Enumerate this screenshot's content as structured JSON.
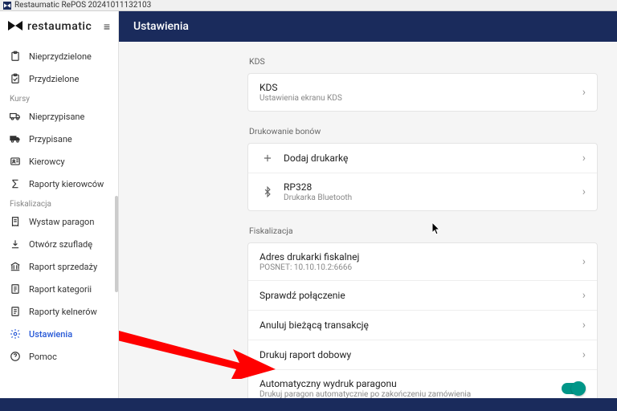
{
  "window": {
    "title": "Restaumatic RePOS 20241011132103"
  },
  "brand": {
    "name": "restaumatic"
  },
  "topbar": {
    "title": "Ustawienia"
  },
  "sidebar": {
    "items": [
      {
        "label": "Nieprzydzielone",
        "icon": "assignment"
      },
      {
        "label": "Przydzielone",
        "icon": "assignment-check"
      }
    ],
    "sections": [
      {
        "label": "Kursy",
        "items": [
          {
            "label": "Nieprzypisane",
            "icon": "truck-out"
          },
          {
            "label": "Przypisane",
            "icon": "truck"
          },
          {
            "label": "Kierowcy",
            "icon": "badge"
          },
          {
            "label": "Raporty kierowców",
            "icon": "sigma"
          }
        ]
      },
      {
        "label": "Fiskalizacja",
        "items": [
          {
            "label": "Wystaw paragon",
            "icon": "receipt"
          },
          {
            "label": "Otwórz szufladę",
            "icon": "download"
          },
          {
            "label": "Raport sprzedaży",
            "icon": "bank"
          },
          {
            "label": "Raport kategorii",
            "icon": "doc"
          },
          {
            "label": "Raporty kelnerów",
            "icon": "doc"
          },
          {
            "label": "Ustawienia",
            "icon": "gear",
            "active": true
          },
          {
            "label": "Pomoc",
            "icon": "help"
          }
        ]
      }
    ]
  },
  "content": {
    "groups": [
      {
        "label": "KDS",
        "rows": [
          {
            "title": "KDS",
            "sub": "Ustawienia ekranu KDS"
          }
        ]
      },
      {
        "label": "Drukowanie bonów",
        "rows": [
          {
            "icon": "plus",
            "title": "Dodaj drukarkę"
          },
          {
            "icon": "bluetooth",
            "title": "RP328",
            "sub": "Drukarka Bluetooth"
          }
        ]
      },
      {
        "label": "Fiskalizacja",
        "rows": [
          {
            "title": "Adres drukarki fiskalnej",
            "sub": "POSNET: 10.10.10.2:6666"
          },
          {
            "title": "Sprawdź połączenie"
          },
          {
            "title": "Anuluj bieżącą transakcję"
          },
          {
            "title": "Drukuj raport dobowy",
            "highlighted": true
          },
          {
            "title": "Automatyczny wydruk paragonu",
            "sub": "Drukuj paragon automatycznie po zakończeniu zamówienia",
            "toggle": true
          }
        ]
      }
    ]
  }
}
